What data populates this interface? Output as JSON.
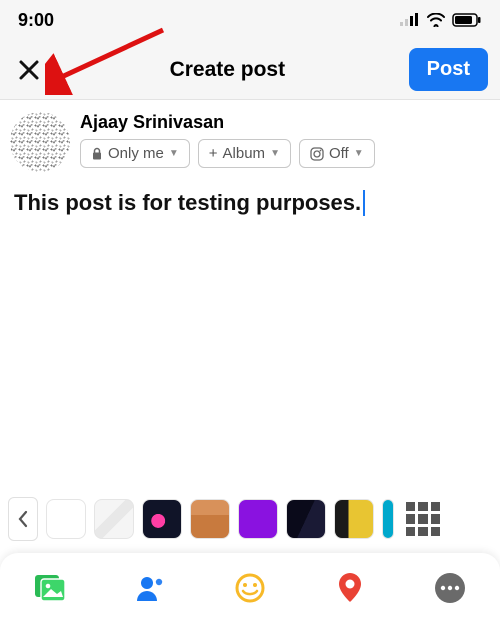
{
  "status": {
    "time": "9:00"
  },
  "header": {
    "title": "Create post",
    "post_label": "Post"
  },
  "user": {
    "name": "Ajaay Srinivasan",
    "audience_label": "Only me",
    "album_label": "Album",
    "instagram_label": "Off"
  },
  "composer": {
    "text": "This post is for testing purposes."
  },
  "bg_strip": {
    "items": [
      {
        "name": "bg-white",
        "style": "background:#ffffff;"
      },
      {
        "name": "bg-lines",
        "style": "background:linear-gradient(135deg,#f5f5f5 0%,#f5f5f5 40%,#e8e8e8 40%,#e8e8e8 60%,#f5f5f5 60%);"
      },
      {
        "name": "bg-rocket",
        "style": "background:radial-gradient(circle at 40% 55%,#ff3ea5 0%,#ff3ea5 22%,transparent 23%),#101428;"
      },
      {
        "name": "bg-zigzag",
        "style": "background:linear-gradient(0deg,#c87a3e 60%,#d8915a 60%);"
      },
      {
        "name": "bg-purple",
        "style": "background:#8a12e0;"
      },
      {
        "name": "bg-stars",
        "style": "background:linear-gradient(115deg,#0a0a1a 0%,#0a0a1a 50%,#1a1a35 50%);"
      },
      {
        "name": "bg-yellow",
        "style": "background:linear-gradient(90deg,#1a1a1a 0%,#1a1a1a 35%,#e8c532 35%);"
      },
      {
        "name": "bg-teal",
        "style": "background:#00a8cc; width:12px;"
      }
    ]
  },
  "icons": {
    "photo": "photo-icon",
    "tag": "tag-people-icon",
    "feeling": "feeling-icon",
    "location": "location-icon",
    "more": "more-icon"
  }
}
